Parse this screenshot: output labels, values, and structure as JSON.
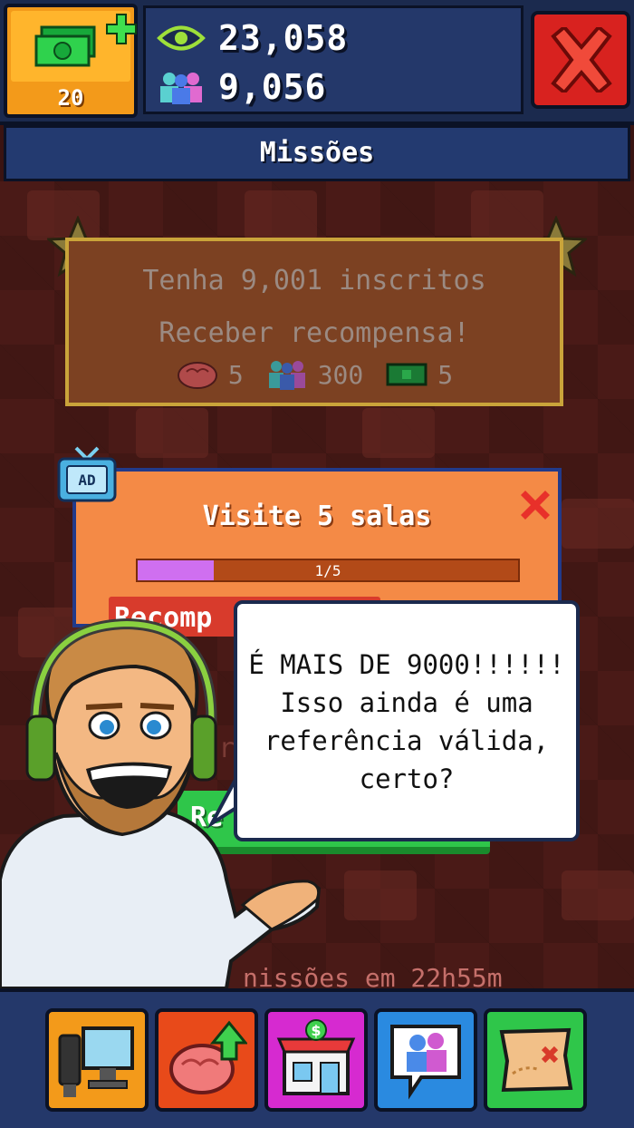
{
  "top": {
    "cash_count": "20",
    "views": "23,058",
    "subscribers": "9,056"
  },
  "title": "Missões",
  "completed_mission": {
    "objective": "Tenha 9,001 inscritos",
    "status": "Receber recompensa!",
    "rewards": [
      {
        "icon": "brain-icon",
        "amount": "5"
      },
      {
        "icon": "subscribers-icon",
        "amount": "300"
      },
      {
        "icon": "cash-icon",
        "amount": "5"
      }
    ]
  },
  "active_mission": {
    "badge": "AD",
    "objective": "Visite 5 salas",
    "progress_text": "1/5",
    "progress_fraction": 0.2,
    "claim_label": "Recomp"
  },
  "partial_mission": {
    "ghost_text": "s r",
    "button_label": "Re"
  },
  "timer_text": "nissões em 22h55m",
  "speech": {
    "lines": [
      "É MAIS DE 9000!!!!!!",
      "Isso ainda é uma",
      "referência válida,",
      "certo?"
    ]
  },
  "nav": [
    {
      "name": "studio-button",
      "icon": "computer-icon"
    },
    {
      "name": "brain-upgrade-button",
      "icon": "brain-up-icon"
    },
    {
      "name": "shop-button",
      "icon": "store-icon"
    },
    {
      "name": "social-button",
      "icon": "chat-people-icon"
    },
    {
      "name": "missions-button",
      "icon": "map-icon"
    }
  ],
  "colors": {
    "cash_button": "#f39a1a",
    "close_button": "#d8221f",
    "mission_card": "#f48a46",
    "progress_fill": "#cf6ff0",
    "green_button": "#2fc64a"
  }
}
